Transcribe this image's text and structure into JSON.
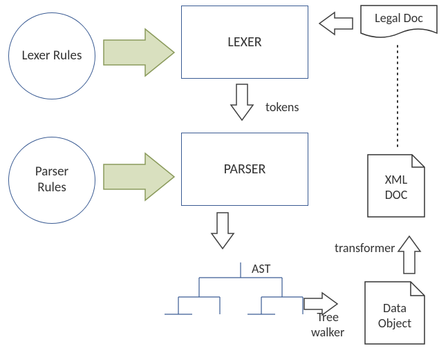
{
  "nodes": {
    "lexer_rules": "Lexer Rules",
    "parser_rules": "Parser\nRules",
    "lexer": "LEXER",
    "parser": "PARSER",
    "legal_doc": "Legal Doc",
    "xml_doc": "XML\nDOC",
    "data_object": "Data\nObject"
  },
  "labels": {
    "tokens": "tokens",
    "ast": "AST",
    "tree_walker": "Tree\nwalker",
    "transformer": "transformer"
  },
  "colors": {
    "arrow_fill": "#d9e0bf",
    "arrow_stroke": "#8a9a5b",
    "line": "#3a5b93",
    "outline_arrow": "#404040"
  }
}
